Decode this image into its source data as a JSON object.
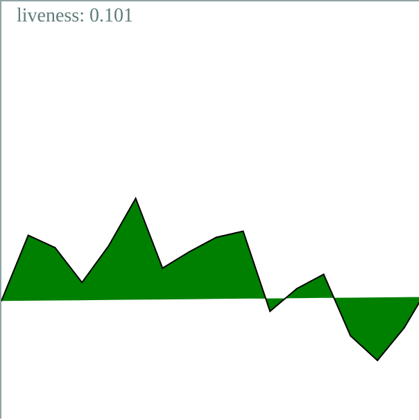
{
  "readout": {
    "label": "liveness:",
    "value": "0.101"
  },
  "colors": {
    "fill": "#008000",
    "stroke": "#000000",
    "text": "#607d7b",
    "border": "#8fa3a3"
  },
  "chart_data": {
    "type": "area",
    "title": "",
    "xlabel": "",
    "ylabel": "",
    "grid": false,
    "x": [
      0,
      1,
      2,
      3,
      4,
      5,
      6,
      7,
      8,
      9,
      10,
      11,
      12,
      13,
      14,
      15,
      16
    ],
    "series": [
      {
        "values": [
          0.0,
          0.32,
          0.26,
          0.09,
          0.27,
          0.5,
          0.16,
          0.24,
          0.31,
          0.34,
          -0.05,
          0.06,
          0.13,
          -0.17,
          -0.29,
          -0.13,
          0.09
        ]
      }
    ],
    "baseline": {
      "start": 0.0,
      "end": 0.02
    },
    "xlim": [
      0,
      15.6
    ],
    "ylim": [
      -0.58,
      1.46
    ]
  }
}
